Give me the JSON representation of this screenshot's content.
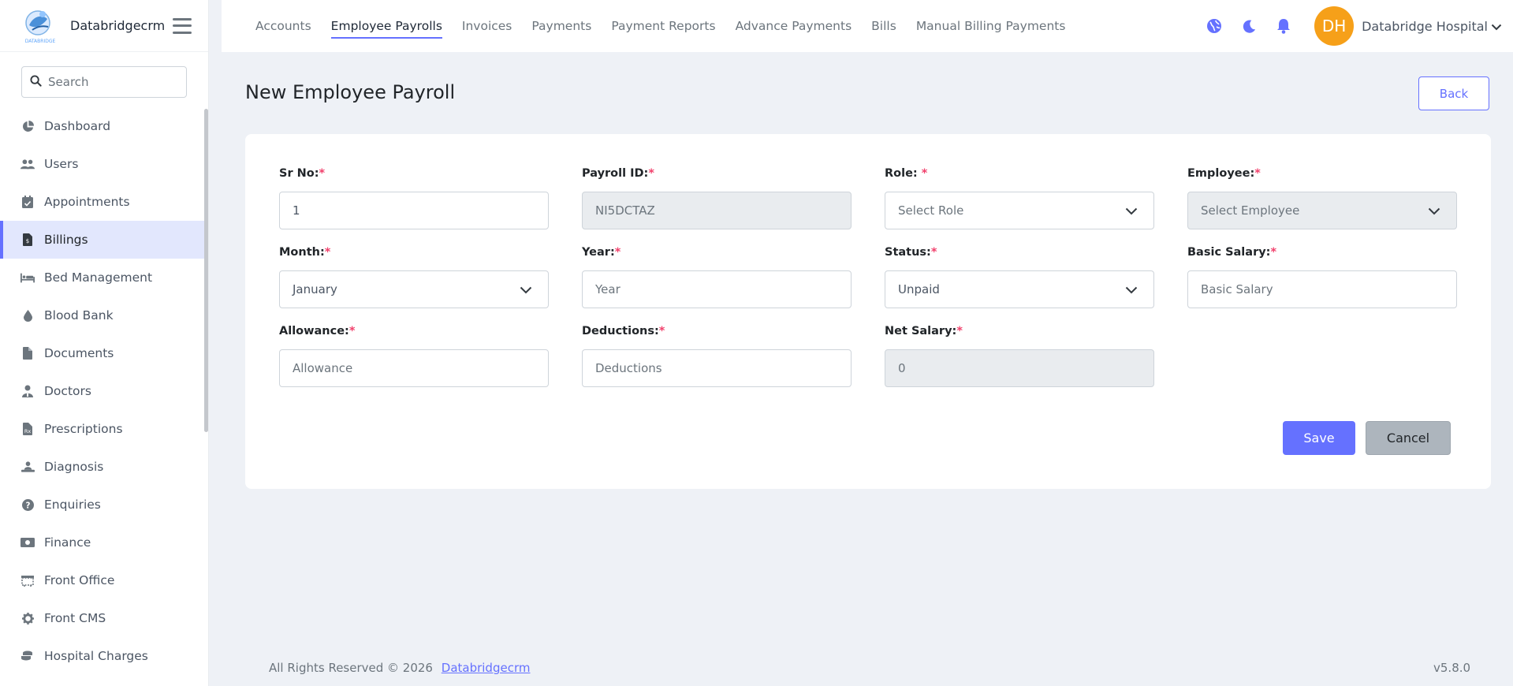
{
  "brand": {
    "name": "Databridgecrm",
    "logo_text": "DATABRIDGE"
  },
  "search": {
    "placeholder": "Search"
  },
  "sidebar": {
    "items": [
      {
        "label": "Dashboard",
        "icon": "chart-pie-icon"
      },
      {
        "label": "Users",
        "icon": "users-icon"
      },
      {
        "label": "Appointments",
        "icon": "calendar-check-icon"
      },
      {
        "label": "Billings",
        "icon": "file-invoice-icon",
        "active": true
      },
      {
        "label": "Bed Management",
        "icon": "bed-icon"
      },
      {
        "label": "Blood Bank",
        "icon": "tint-icon"
      },
      {
        "label": "Documents",
        "icon": "file-icon"
      },
      {
        "label": "Doctors",
        "icon": "user-doctor-icon"
      },
      {
        "label": "Prescriptions",
        "icon": "file-prescription-icon"
      },
      {
        "label": "Diagnosis",
        "icon": "person-diagnosis-icon"
      },
      {
        "label": "Enquiries",
        "icon": "question-circle-icon"
      },
      {
        "label": "Finance",
        "icon": "money-bill-icon"
      },
      {
        "label": "Front Office",
        "icon": "dumpster-icon"
      },
      {
        "label": "Front CMS",
        "icon": "gear-icon"
      },
      {
        "label": "Hospital Charges",
        "icon": "coins-icon"
      }
    ]
  },
  "topnav": {
    "tabs": [
      {
        "label": "Accounts"
      },
      {
        "label": "Employee Payrolls",
        "active": true
      },
      {
        "label": "Invoices"
      },
      {
        "label": "Payments"
      },
      {
        "label": "Payment Reports"
      },
      {
        "label": "Advance Payments"
      },
      {
        "label": "Bills"
      },
      {
        "label": "Manual Billing Payments"
      }
    ],
    "user": {
      "initials": "DH",
      "name": "Databridge Hospital"
    },
    "colors": {
      "accent": "#6571ff",
      "avatar": "#f6a019"
    }
  },
  "page": {
    "title": "New Employee Payroll",
    "back_label": "Back"
  },
  "form": {
    "sr_no": {
      "label": "Sr No:",
      "value": "1"
    },
    "payroll_id": {
      "label": "Payroll ID:",
      "value": "NI5DCTAZ"
    },
    "role": {
      "label": "Role: ",
      "value": "Select Role"
    },
    "employee": {
      "label": "Employee:",
      "value": "Select Employee"
    },
    "month": {
      "label": "Month:",
      "value": "January"
    },
    "year": {
      "label": "Year:",
      "placeholder": "Year"
    },
    "status": {
      "label": "Status:",
      "value": "Unpaid"
    },
    "basic_salary": {
      "label": "Basic Salary:",
      "placeholder": "Basic Salary"
    },
    "allowance": {
      "label": "Allowance:",
      "placeholder": "Allowance"
    },
    "deductions": {
      "label": "Deductions:",
      "placeholder": "Deductions"
    },
    "net_salary": {
      "label": "Net Salary:",
      "value": "0"
    },
    "required_mark": "*",
    "save_label": "Save",
    "cancel_label": "Cancel"
  },
  "footer": {
    "copyright": "All Rights Reserved © 2026",
    "link": "Databridgecrm",
    "version": "v5.8.0"
  }
}
